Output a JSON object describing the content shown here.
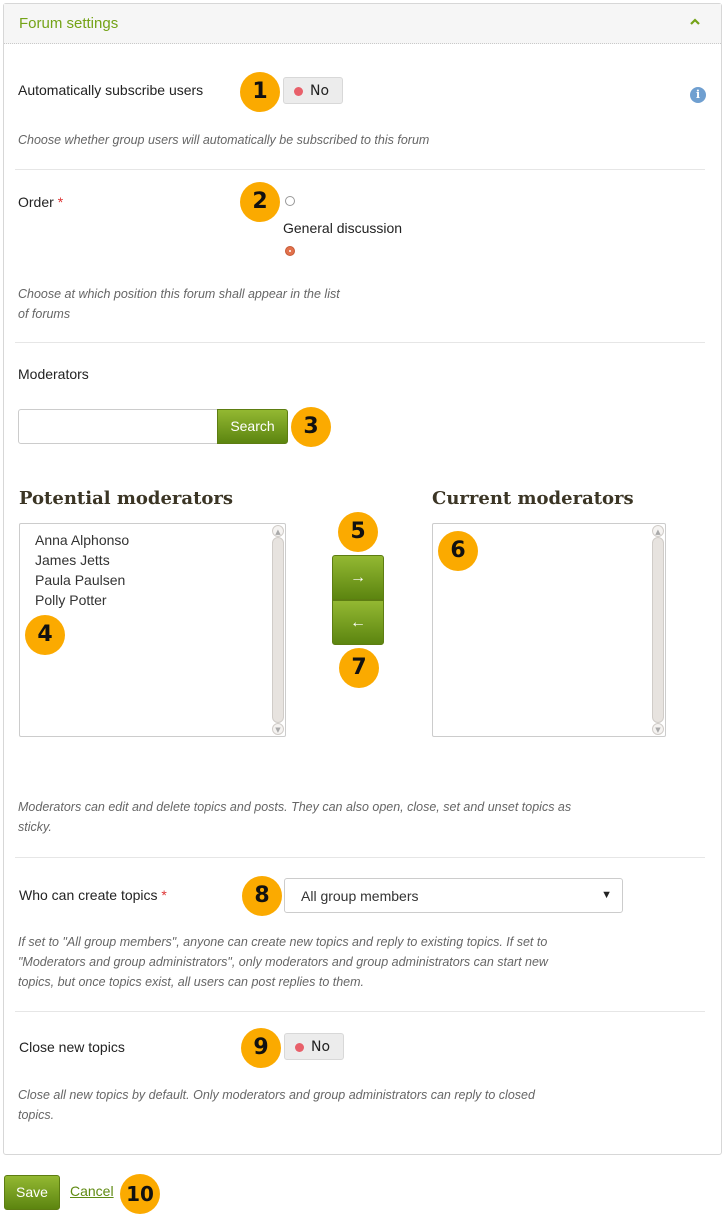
{
  "panel": {
    "title": "Forum settings"
  },
  "fields": {
    "auto_subscribe": {
      "label": "Automatically subscribe users",
      "value": "No",
      "description": "Choose whether group users will automatically be subscribed to this forum"
    },
    "order": {
      "label": "Order",
      "required_marker": "*",
      "options": [
        "",
        "General discussion"
      ],
      "selected_index": 1,
      "description_line1": "Choose at which position this forum shall appear in the list",
      "description_line2": "of forums"
    },
    "moderators": {
      "label": "Moderators",
      "search_value": "",
      "search_button": "Search",
      "potential_heading": "Potential moderators",
      "current_heading": "Current moderators",
      "potential_list": [
        "Anna Alphonso",
        "James Jetts",
        "Paula Paulsen",
        "Polly Potter"
      ],
      "current_list": [],
      "add_arrow": "→",
      "remove_arrow": "←",
      "description_line1": "Moderators can edit and delete topics and posts. They can also open, close, set and unset topics as",
      "description_line2": "sticky."
    },
    "who_can_create": {
      "label": "Who can create topics",
      "required_marker": "*",
      "selected": "All group members",
      "caret": "▼",
      "description_line1": "If set to \"All group members\", anyone can create new topics and reply to existing topics. If set to",
      "description_line2": "\"Moderators and group administrators\", only moderators and group administrators can start new",
      "description_line3": "topics, but once topics exist, all users can post replies to them."
    },
    "close_new_topics": {
      "label": "Close new topics",
      "value": "No",
      "description_line1": "Close all new topics by default. Only moderators and group administrators can reply to closed",
      "description_line2": "topics."
    }
  },
  "actions": {
    "save": "Save",
    "cancel": "Cancel"
  },
  "callouts": [
    "1",
    "2",
    "3",
    "4",
    "5",
    "6",
    "7",
    "8",
    "9",
    "10"
  ],
  "icons": {
    "info": "i",
    "collapse": "chevron-up-icon"
  },
  "colors": {
    "accent_green": "#74a317",
    "callout_orange": "#fbaa00",
    "toggle_off_dot": "#e8606a",
    "info_blue": "#6f9fd0"
  }
}
